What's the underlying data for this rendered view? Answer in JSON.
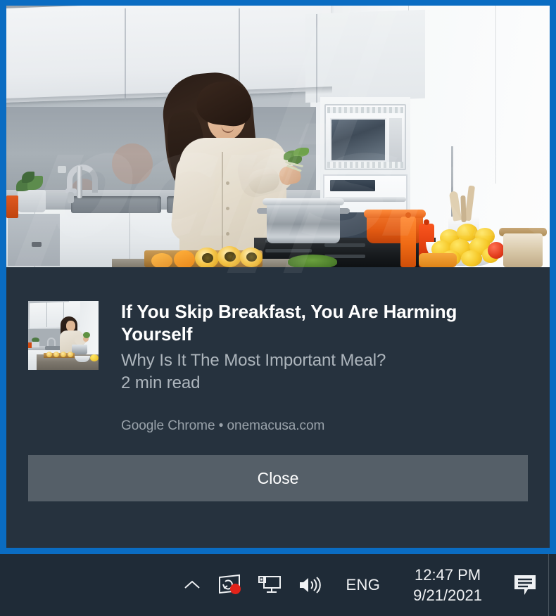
{
  "window": {
    "type": "windows-toast-notification",
    "accent_border_color": "#0a6cc2",
    "body_background_color": "#26323e"
  },
  "notification": {
    "hero_image_alt": "Woman cooking in a modern white kitchen with lemons and pots",
    "thumbnail_alt": "Thumbnail of woman cooking in kitchen",
    "title": "If You Skip Breakfast, You Are Harming Yourself",
    "subtitle": "Why Is It The Most Important Meal?",
    "read_time": "2 min read",
    "source": "Google Chrome • onemacusa.com",
    "app_name": "Google Chrome",
    "site": "onemacusa.com",
    "close_label": "Close"
  },
  "watermark": {
    "text": "pcrisk.com"
  },
  "taskbar": {
    "background_color": "#1f2b37",
    "tray_icons": [
      {
        "name": "show-hidden-icons-chevron",
        "glyph": "chevron-up"
      },
      {
        "name": "onedrive-sync-icon",
        "glyph": "screen-sync",
        "badge": true,
        "badge_color": "#e2231a"
      },
      {
        "name": "network-display-icon",
        "glyph": "monitor"
      },
      {
        "name": "volume-icon",
        "glyph": "speaker"
      }
    ],
    "language": "ENG",
    "time": "12:47 PM",
    "date": "9/21/2021",
    "action_center": "action-center-icon"
  }
}
